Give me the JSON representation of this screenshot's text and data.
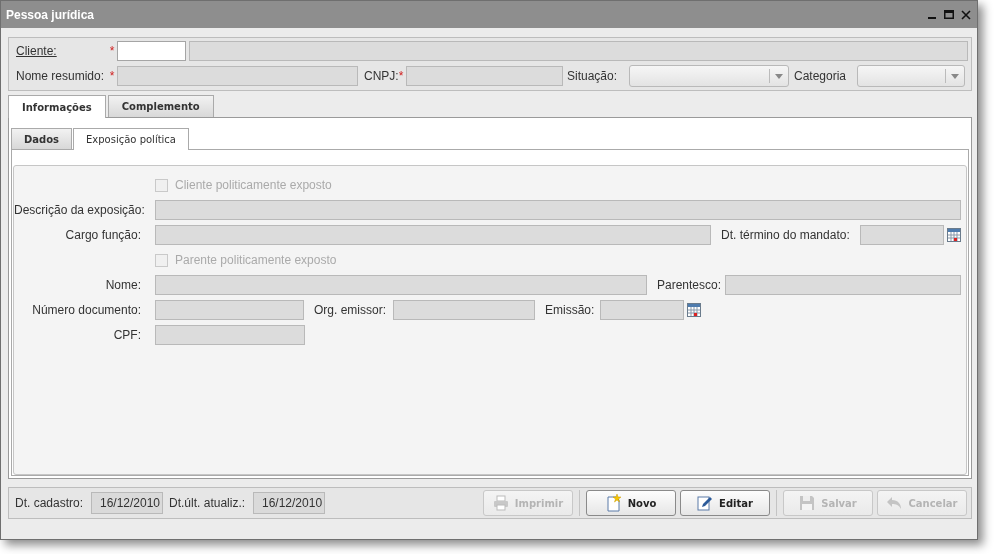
{
  "window": {
    "title": "Pessoa jurídica"
  },
  "header": {
    "cliente": {
      "label": "Cliente:",
      "required_mark": "*"
    },
    "nome_resumido": {
      "label": "Nome resumido:",
      "required_mark": "*"
    },
    "cnpj": {
      "label": "CNPJ:",
      "required_mark": "*"
    },
    "situacao": {
      "label": "Situação:"
    },
    "categoria": {
      "label": "Categoria"
    }
  },
  "tabs": [
    {
      "label": "Informações",
      "selected": true
    },
    {
      "label": "Complemento",
      "selected": false
    }
  ],
  "subtabs": [
    {
      "label": "Dados",
      "selected": false
    },
    {
      "label": "Exposição política",
      "selected": true
    }
  ],
  "exposicao": {
    "cliente_exposto": {
      "label": "Cliente politicamente exposto",
      "checked": false,
      "disabled": true
    },
    "descricao": {
      "label": "Descrição da exposição:"
    },
    "cargo": {
      "label": "Cargo função:"
    },
    "dt_termino": {
      "label": "Dt. término do mandato:"
    },
    "parente_exposto": {
      "label": "Parente politicamente exposto",
      "checked": false,
      "disabled": true
    },
    "nome": {
      "label": "Nome:"
    },
    "parentesco": {
      "label": "Parentesco:"
    },
    "numero_documento": {
      "label": "Número documento:"
    },
    "org_emissor": {
      "label": "Org. emissor:"
    },
    "emissao": {
      "label": "Emissão:"
    },
    "cpf": {
      "label": "CPF:"
    }
  },
  "footer": {
    "dt_cadastro": {
      "label": "Dt. cadastro:",
      "value": "16/12/2010"
    },
    "dt_atualiz": {
      "label": "Dt.últ. atualiz.:",
      "value": "16/12/2010"
    },
    "buttons": [
      {
        "label": "Imprimir",
        "kind": "print",
        "disabled": true
      },
      {
        "label": "Novo",
        "kind": "new",
        "disabled": false
      },
      {
        "label": "Editar",
        "kind": "edit",
        "disabled": false
      },
      {
        "label": "Salvar",
        "kind": "save",
        "disabled": true
      },
      {
        "label": "Cancelar",
        "kind": "cancel",
        "disabled": true
      }
    ]
  }
}
